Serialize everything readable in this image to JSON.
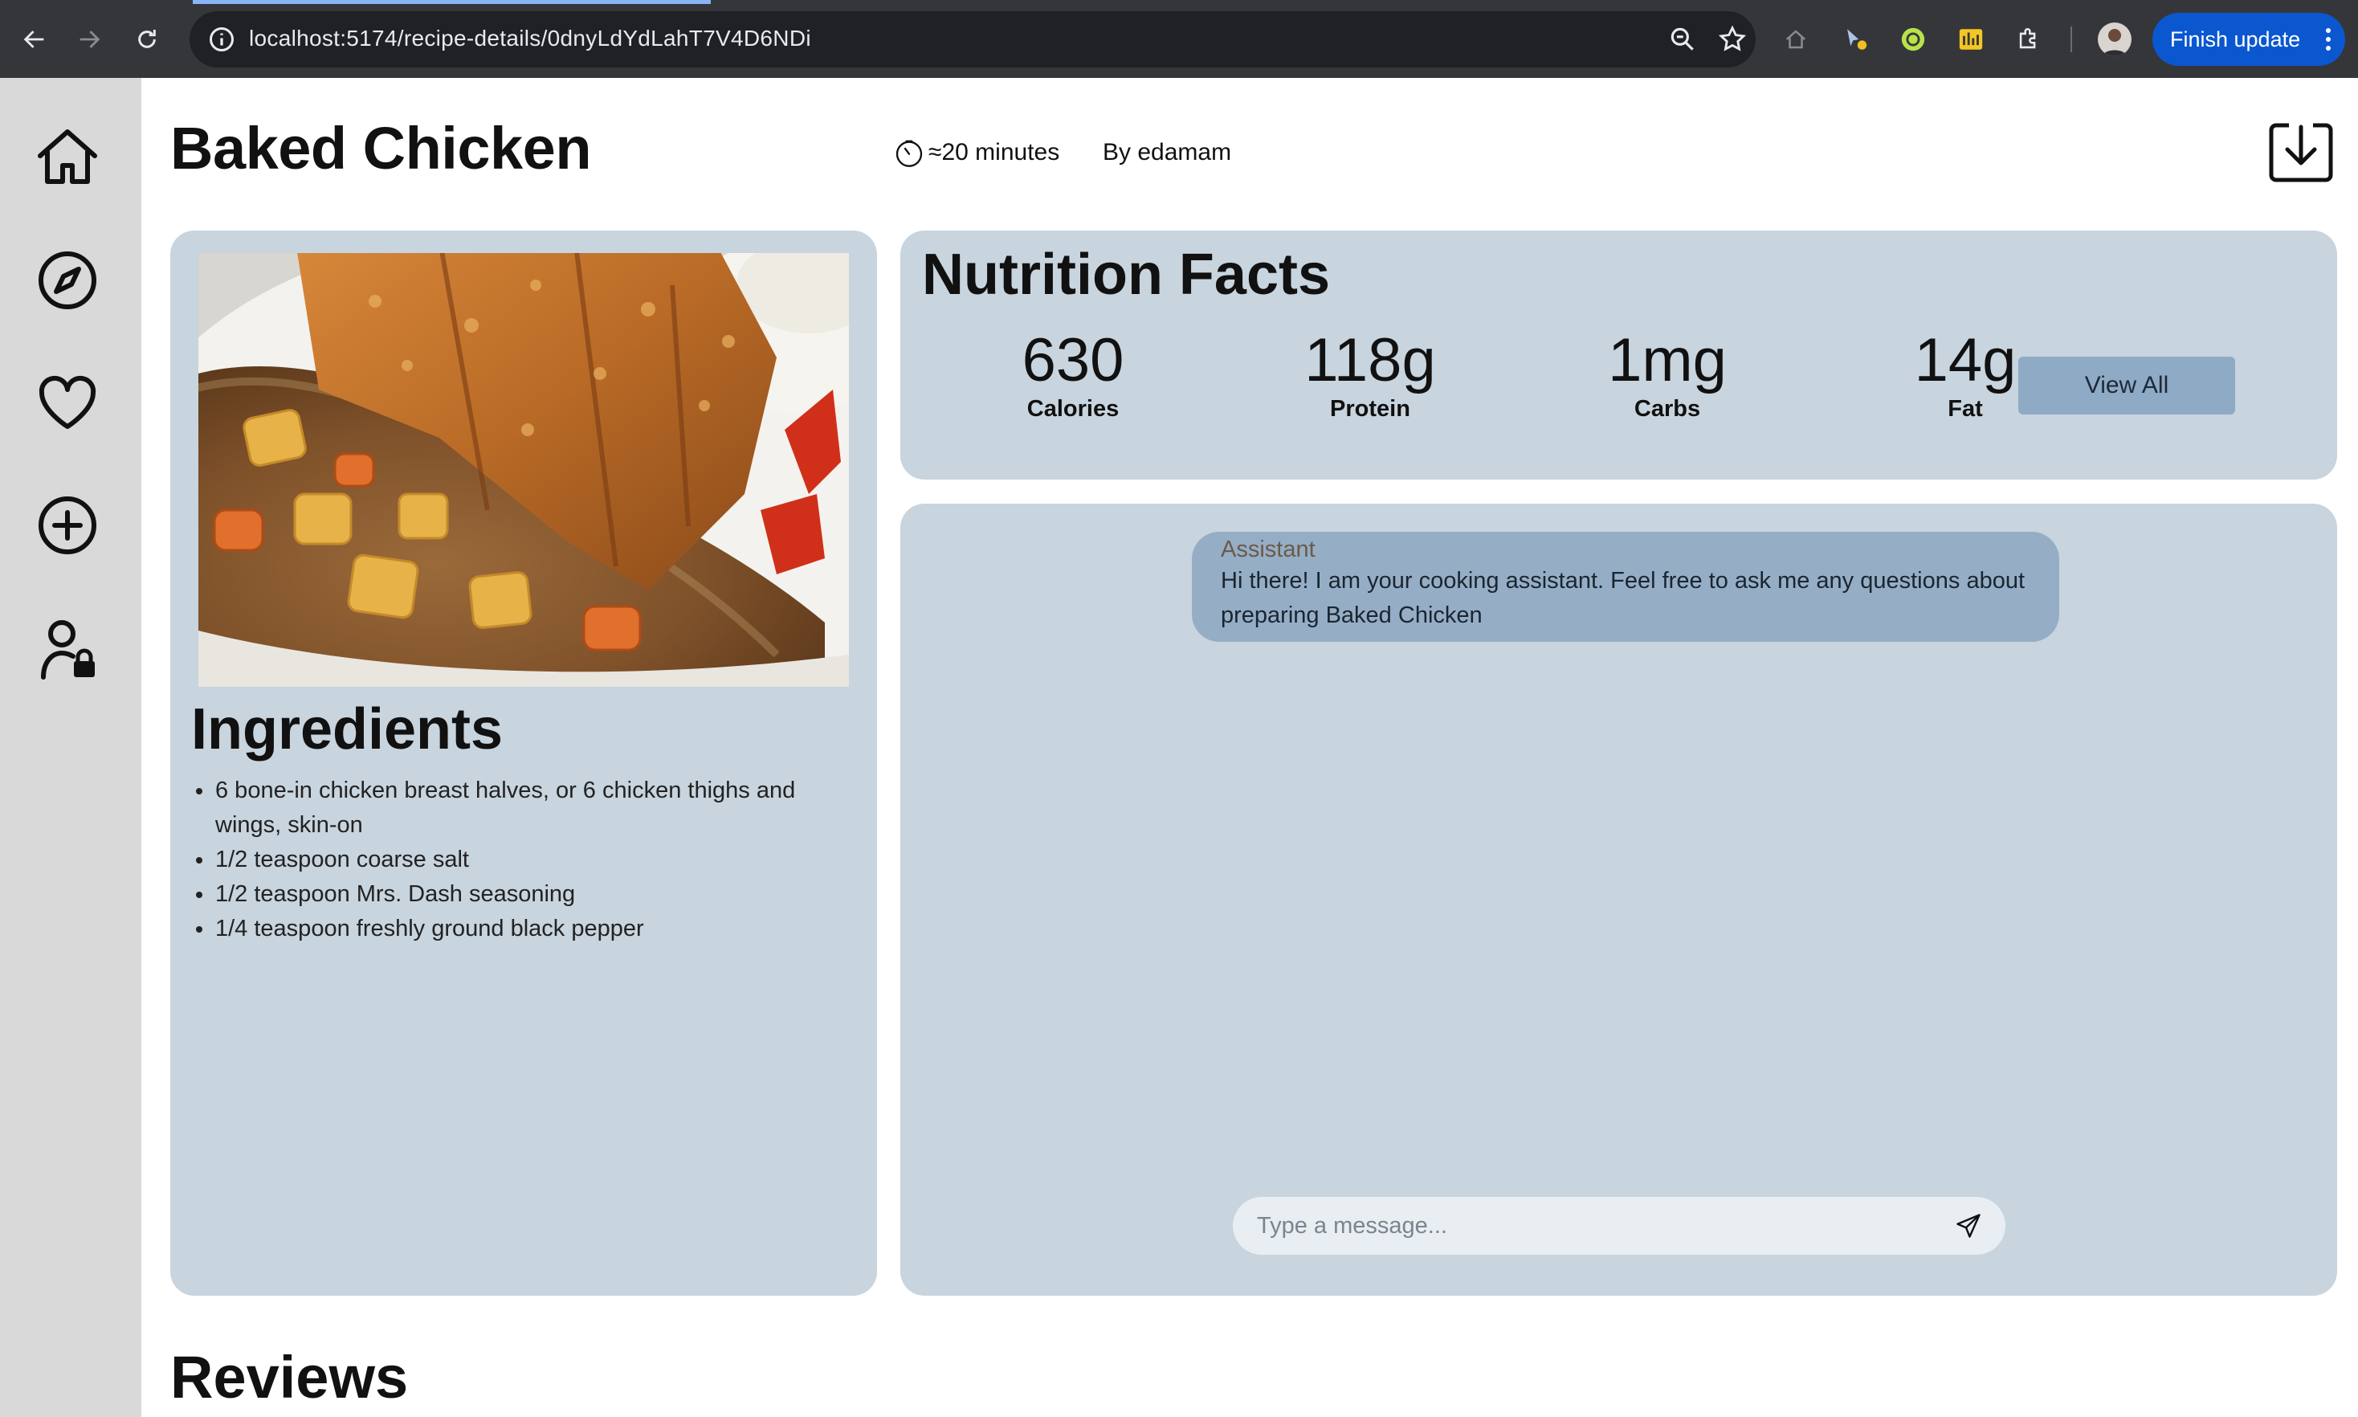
{
  "browser": {
    "url": "localhost:5174/recipe-details/0dnyLdYdLahT7V4D6NDi",
    "update_button": "Finish update"
  },
  "sidebar": {
    "items": [
      {
        "icon": "home-icon"
      },
      {
        "icon": "compass-icon"
      },
      {
        "icon": "heart-icon"
      },
      {
        "icon": "plus-circle-icon"
      },
      {
        "icon": "user-lock-icon"
      }
    ]
  },
  "recipe": {
    "title": "Baked Chicken",
    "time": "≈20 minutes",
    "author": "By edamam"
  },
  "ingredients": {
    "title": "Ingredients",
    "items": [
      "6 bone-in chicken breast halves, or 6 chicken thighs and wings, skin-on",
      "1/2 teaspoon coarse salt",
      "1/2 teaspoon Mrs. Dash seasoning",
      "1/4 teaspoon freshly ground black pepper"
    ]
  },
  "nutrition": {
    "title": "Nutrition Facts",
    "facts": [
      {
        "value": "630",
        "label": "Calories"
      },
      {
        "value": "118g",
        "label": "Protein"
      },
      {
        "value": "1mg",
        "label": "Carbs"
      },
      {
        "value": "14g",
        "label": "Fat"
      }
    ],
    "view_all": "View All"
  },
  "chat": {
    "messages": [
      {
        "sender": "Assistant",
        "text_line1": "Hi there! I am your cooking assistant. Feel free to ask me any questions about",
        "text_line2": "preparing Baked Chicken"
      }
    ],
    "input_placeholder": "Type a message..."
  },
  "reviews": {
    "title": "Reviews"
  },
  "colors": {
    "panel_bg": "#c8d4de",
    "bubble_bg": "#95aec6",
    "button_bg": "#8faac4",
    "sidebar_bg": "#d9d9d9"
  }
}
